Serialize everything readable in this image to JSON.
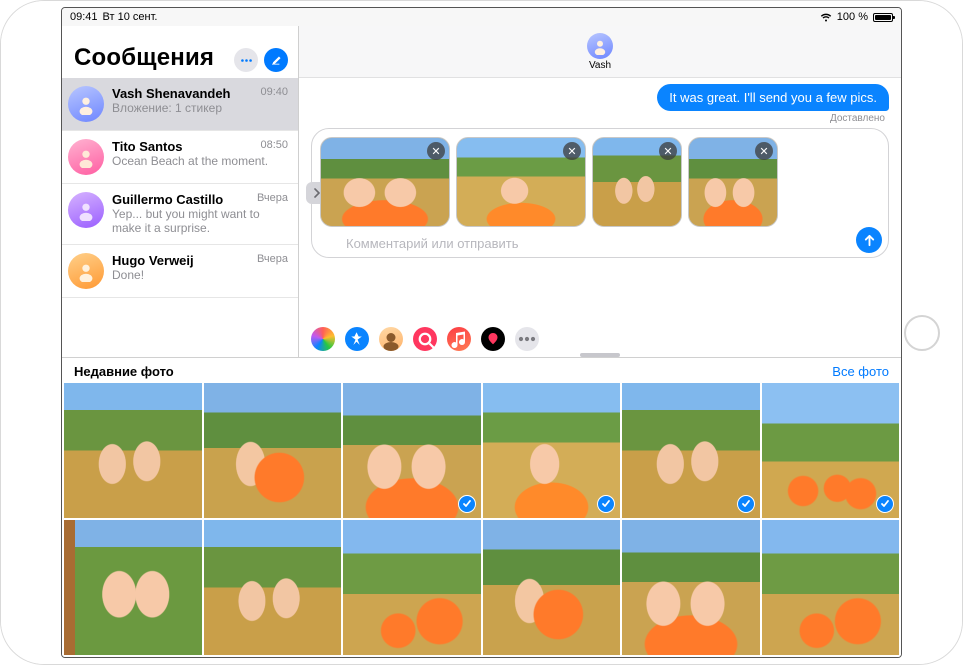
{
  "status": {
    "time": "09:41",
    "date": "Вт 10 сент.",
    "battery": "100 %"
  },
  "sidebar": {
    "title": "Сообщения",
    "conversations": [
      {
        "name": "Vash Shenavandeh",
        "time": "09:40",
        "preview": "Вложение: 1 стикер",
        "avatar": "blue"
      },
      {
        "name": "Tito Santos",
        "time": "08:50",
        "preview": "Ocean Beach at the moment.",
        "avatar": "pink"
      },
      {
        "name": "Guillermo Castillo",
        "time": "Вчера",
        "preview": "Yep... but you might want to make it a surprise.",
        "avatar": "purple"
      },
      {
        "name": "Hugo Verweij",
        "time": "Вчера",
        "preview": "Done!",
        "avatar": "orange"
      }
    ]
  },
  "chat": {
    "contact": "Vash",
    "message": "It was great. I'll send you a few pics.",
    "delivered": "Доставлено",
    "staged_count": 4,
    "input_placeholder": "Комментарий или отправить"
  },
  "drawer": {
    "title": "Недавние фото",
    "all_link": "Все фото",
    "selected_indices": [
      2,
      3,
      4,
      5
    ]
  }
}
